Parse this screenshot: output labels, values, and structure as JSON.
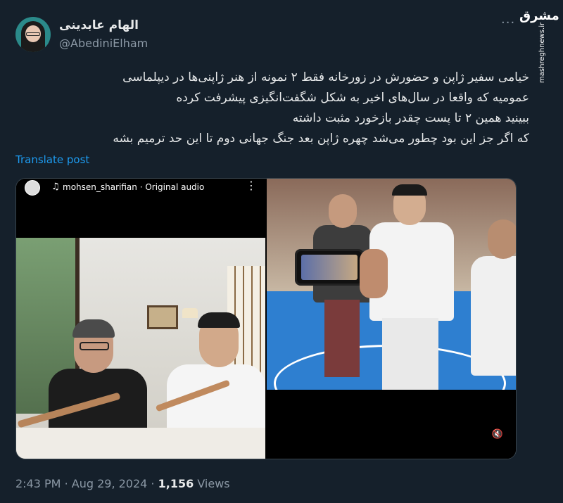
{
  "author": {
    "display_name": "الهام عابدینی",
    "handle": "@AbediniElham"
  },
  "watermark": {
    "logo_text": "مشرق",
    "url": "mashreghnews.ir"
  },
  "tweet": {
    "lines": [
      "خیامی سفیر ژاپن و حضورش در زورخانه فقط ۲ نمونه از هنر ژاپنی‌ها در دیپلماسی",
      "عمومیه که واقعا در سال‌های اخیر به شکل شگفت‌انگیزی پیشرفت کرده",
      "ببینید همین ۲ تا پست چقدر بازخورد مثبت داشته",
      "که اگر جز این بود چطور می‌شد چهره ژاپن بعد جنگ جهانی دوم تا این حد ترمیم بشه"
    ],
    "translate_label": "Translate post"
  },
  "media": {
    "left_audio_label": "mohsen_sharifian · Original audio",
    "icons": [
      "music-note-icon",
      "more-dots-icon",
      "mute-icon"
    ]
  },
  "footer": {
    "time": "2:43 PM",
    "date": "Aug 29, 2024",
    "views_count": "1,156",
    "views_label": "Views",
    "separator": "·"
  },
  "colors": {
    "background": "#15202b",
    "text": "#e7e9ea",
    "muted": "#8b98a5",
    "link": "#1d9bf0"
  }
}
